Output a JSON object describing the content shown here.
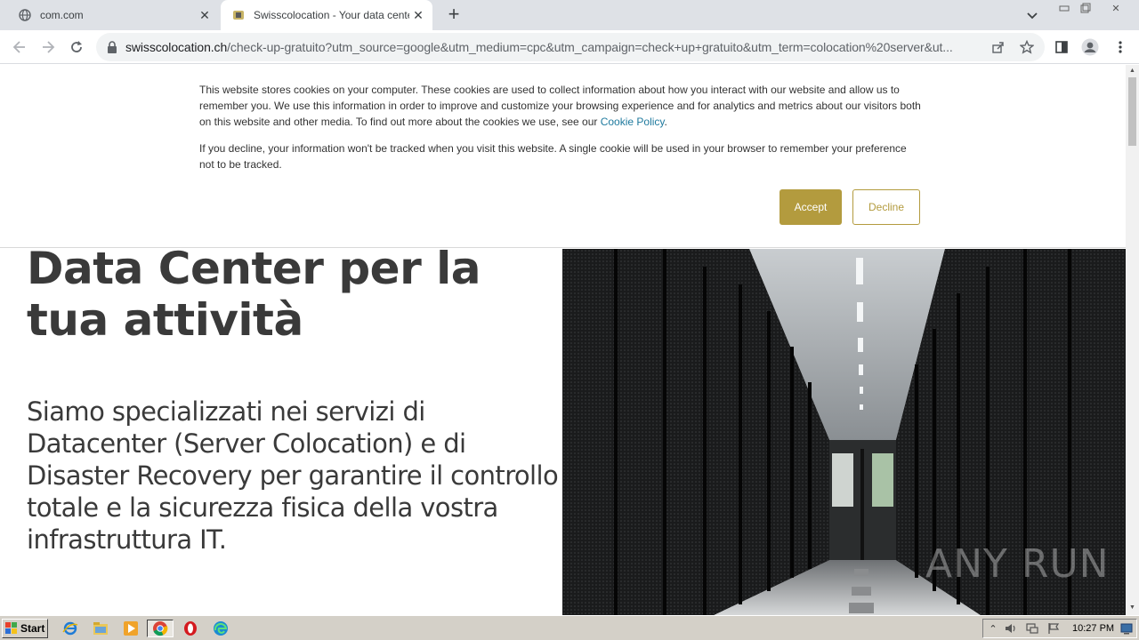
{
  "browser": {
    "tabs": [
      {
        "title": "com.com",
        "active": false,
        "icon": "globe-icon"
      },
      {
        "title": "Swisscolocation - Your data center",
        "active": true,
        "icon": "swisscolocation-favicon"
      }
    ],
    "new_tab_label": "+",
    "url_host": "swisscolocation.ch",
    "url_path": "/check-up-gratuito?utm_source=google&utm_medium=cpc&utm_campaign=check+up+gratuito&utm_term=colocation%20server&ut..."
  },
  "cookie_banner": {
    "paragraph1": "This website stores cookies on your computer. These cookies are used to collect information about how you interact with our website and allow us to remember you. We use this information in order to improve and customize your browsing experience and for analytics and metrics about our visitors both on this website and other media. To find out more about the cookies we use, see our ",
    "policy_link": "Cookie Policy",
    "paragraph1_end": ".",
    "paragraph2": "If you decline, your information won't be tracked when you visit this website. A single cookie will be used in your browser to remember your preference not to be tracked.",
    "accept_label": "Accept",
    "decline_label": "Decline",
    "accent_color": "#b39b3e"
  },
  "hero": {
    "title": "Data Center per la tua attività",
    "subtitle": "Siamo specializzati nei servizi di Datacenter (Server Colocation) e di Disaster Recovery per garantire il controllo totale e la sicurezza fisica della vostra infrastruttura IT.",
    "image_alt": "data center server aisle"
  },
  "watermark": "ANY RUN",
  "taskbar": {
    "start_label": "Start",
    "apps": [
      "ie-icon",
      "explorer-icon",
      "media-player-icon",
      "chrome-icon",
      "opera-icon",
      "edge-icon"
    ],
    "clock": "10:27 PM"
  }
}
